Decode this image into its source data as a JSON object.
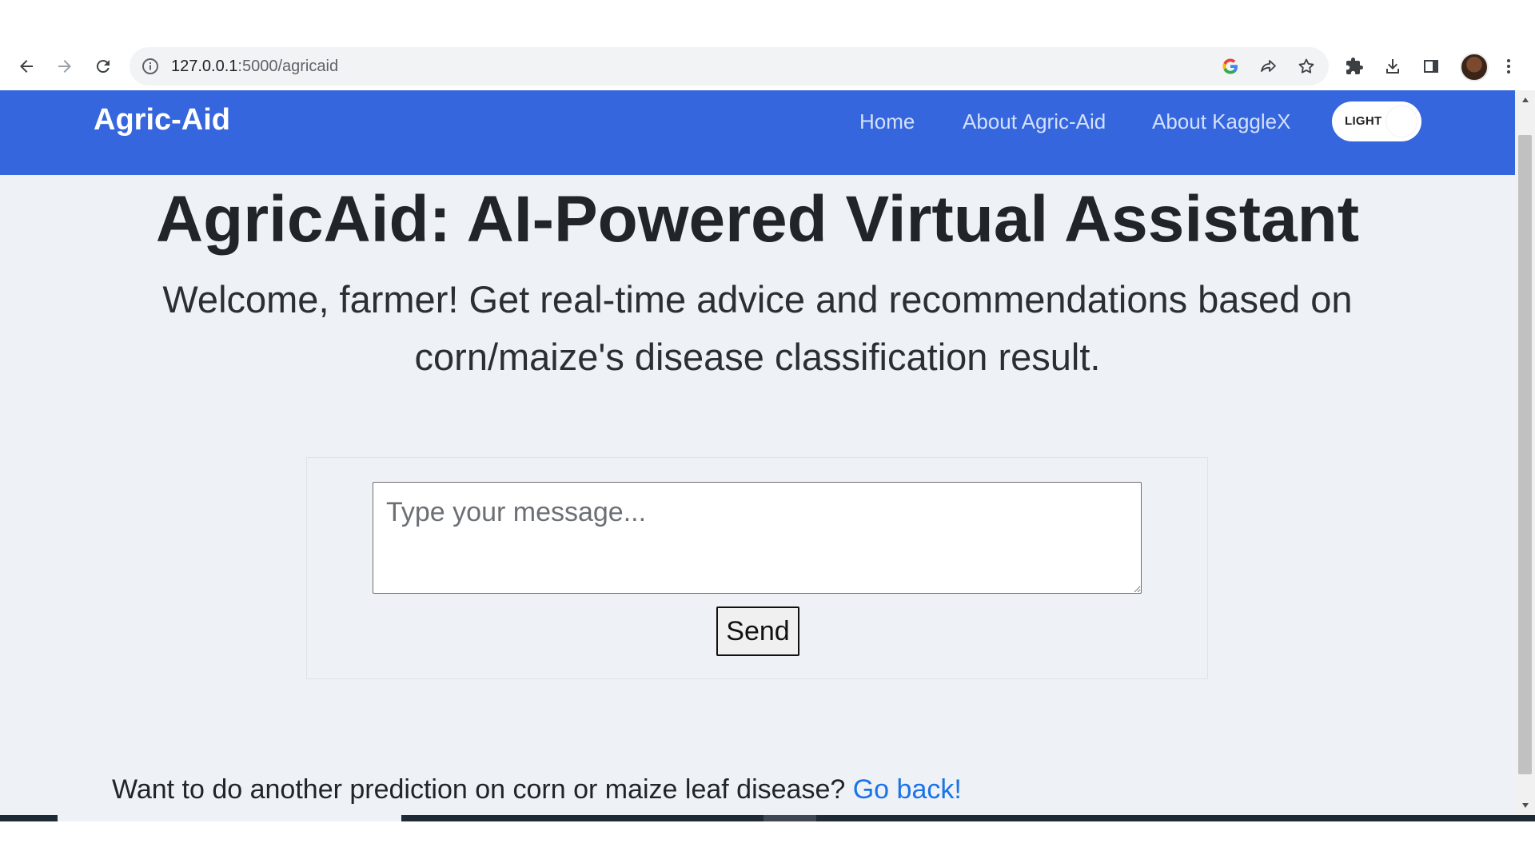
{
  "browser": {
    "url_host": "127.0.0.1",
    "url_path": ":5000/agricaid",
    "nav_icons": [
      "back-arrow-icon",
      "forward-arrow-icon",
      "reload-icon"
    ],
    "omnibox_icons": [
      "site-info-icon",
      "google-lens-icon",
      "share-icon",
      "bookmark-star-icon"
    ],
    "toolbar_icons": [
      "extensions-icon",
      "download-icon",
      "side-panel-icon",
      "profile-avatar",
      "kebab-menu-icon"
    ]
  },
  "navbar": {
    "brand": "Agric-Aid",
    "links": [
      "Home",
      "About Agric-Aid",
      "About KaggleX"
    ],
    "theme_toggle_label": "LIGHT",
    "background_color": "#3566dd"
  },
  "hero": {
    "title": "AgricAid: AI-Powered Virtual Assistant",
    "subtitle": "Welcome, farmer! Get real-time advice and recommendations based on corn/maize's disease classification result."
  },
  "chat": {
    "input_value": "",
    "input_placeholder": "Type your message...",
    "send_label": "Send"
  },
  "footer": {
    "prompt": "Want to do another prediction on corn or maize leaf disease?",
    "link_label": "Go back!",
    "link_color": "#1a73e8"
  }
}
